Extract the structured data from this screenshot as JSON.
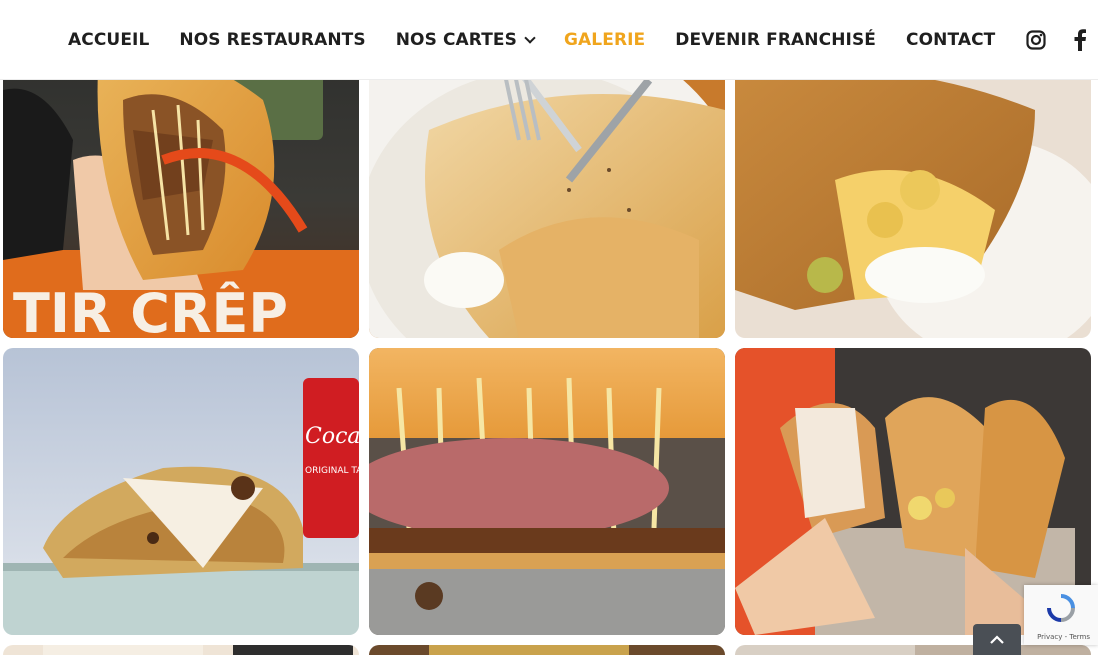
{
  "nav": {
    "items": [
      {
        "label": "ACCUEIL",
        "active": false,
        "dropdown": false
      },
      {
        "label": "NOS RESTAURANTS",
        "active": false,
        "dropdown": false
      },
      {
        "label": "NOS CARTES",
        "active": false,
        "dropdown": true
      },
      {
        "label": "GALERIE",
        "active": true,
        "dropdown": false
      },
      {
        "label": "DEVENIR FRANCHISÉ",
        "active": false,
        "dropdown": false
      },
      {
        "label": "CONTACT",
        "active": false,
        "dropdown": false
      }
    ],
    "social": [
      "instagram-icon",
      "facebook-icon"
    ],
    "active_color": "#f0a51d",
    "text_color": "#1f1f1f"
  },
  "gallery": {
    "photos": [
      {
        "subject": "hand holding folded crepe with shredded meat and fries in front of shop sign"
      },
      {
        "subject": "crepe on white plate with fork and cream sauce"
      },
      {
        "subject": "folded crepe with potatoes and white sauce on plate"
      },
      {
        "subject": "folded crepe on counter next to a cola can"
      },
      {
        "subject": "close-up of crepe with melted cheese and ham"
      },
      {
        "subject": "two hands holding several filled crepes in paper wraps"
      },
      {
        "subject": "partially visible photo"
      },
      {
        "subject": "partially visible photo"
      },
      {
        "subject": "partially visible photo"
      }
    ],
    "visible_text": {
      "sign_text": "TIR  CRÊP",
      "can_text": "Coca-Cola",
      "can_subtext": "ORIGINAL TASTE"
    }
  },
  "recaptcha": {
    "text": "Privacy - Terms"
  },
  "back_to_top": {
    "icon": "chevron-up-icon"
  }
}
